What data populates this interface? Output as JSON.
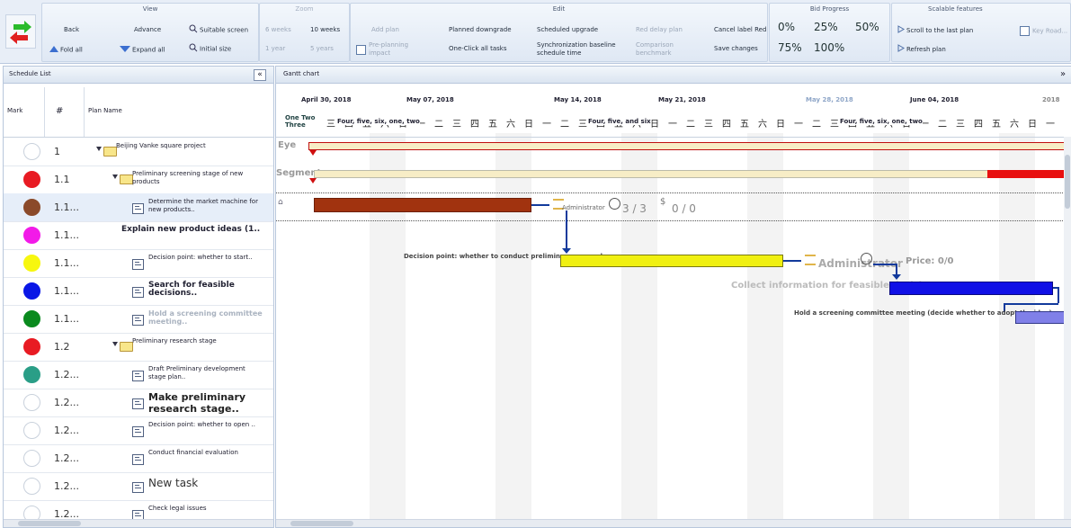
{
  "ribbon": {
    "view": {
      "title": "View",
      "back": "Back",
      "advance": "Advance",
      "suitable_screen": "Suitable screen",
      "fold_all": "Fold all",
      "expand_all": "Expand all",
      "initial_size": "Initial size"
    },
    "zoom": {
      "title": "Zoom",
      "six_weeks": "6 weeks",
      "ten_weeks": "10 weeks",
      "one_year": "1 year",
      "five_years": "5 years"
    },
    "edit": {
      "title": "Edit",
      "add_plan": "Add plan",
      "planned_downgrade": "Planned downgrade",
      "scheduled_upgrade": "Scheduled upgrade",
      "red_delay_plan": "Red delay plan",
      "cancel_label_red": "Cancel label Red",
      "preplanning_impact": "Pre-planning impact",
      "one_click_all_tasks": "One-Click all tasks",
      "sync_baseline": "Synchronization baseline schedule time",
      "comparison_benchmark": "Comparison benchmark",
      "save_changes": "Save changes"
    },
    "bid": {
      "title": "Bid Progress",
      "p0": "0%",
      "p25": "25%",
      "p50": "50%",
      "p75": "75%",
      "p100": "100%"
    },
    "scalable": {
      "title": "Scalable features",
      "scroll_last": "Scroll to the last plan",
      "refresh": "Refresh plan",
      "key_road": "Key Road..."
    }
  },
  "schedule": {
    "title": "Schedule List",
    "cols": {
      "mark": "Mark",
      "num": "#",
      "name": "Plan Name"
    },
    "rows": [
      {
        "num": "1",
        "name": "Beijing Vanke square project",
        "color": "#ffffff"
      },
      {
        "num": "1.1",
        "name": "Preliminary screening stage of new products",
        "color": "#e81b23"
      },
      {
        "num": "1.1...",
        "name": "Determine the market machine for new products..",
        "color": "#8b4a2a"
      },
      {
        "num": "1.1...",
        "name": "Explain new product ideas (1..",
        "color": "#f21ae8"
      },
      {
        "num": "1.1...",
        "name": "Decision point: whether to start..",
        "color": "#f7f70f"
      },
      {
        "num": "1.1...",
        "name": "Search for feasible decisions..",
        "color": "#0a17e6"
      },
      {
        "num": "1.1...",
        "name": "Hold a screening committee meeting..",
        "color": "#0a8a1e"
      },
      {
        "num": "1.2",
        "name": "Preliminary research stage",
        "color": "#e81b23"
      },
      {
        "num": "1.2...",
        "name": "Draft Preliminary development stage plan..",
        "color": "#2a9e87"
      },
      {
        "num": "1.2...",
        "name": "Make preliminary research stage..",
        "color": "#ffffff"
      },
      {
        "num": "1.2...",
        "name": "Decision point: whether to open ..",
        "color": "#ffffff"
      },
      {
        "num": "1.2...",
        "name": "Conduct financial evaluation",
        "color": "#ffffff"
      },
      {
        "num": "1.2...",
        "name": "New task",
        "color": "#ffffff"
      },
      {
        "num": "1.2...",
        "name": "Check legal issues",
        "color": "#ffffff"
      }
    ]
  },
  "gantt": {
    "title": "Gantt chart",
    "dates": [
      "April 30, 2018",
      "May 07, 2018",
      "May 14, 2018",
      "May 21, 2018",
      "May 28, 2018",
      "June 04, 2018",
      "2018"
    ],
    "week_label_1": "One Two Three",
    "week_label_2": "Four, five, six, one, two",
    "week_label_3": "Four, five, and six",
    "eye": "Eye",
    "segment": "Segment",
    "admin_small": "Administrator",
    "progress_a": "3 / 3",
    "progress_b": "0 / 0",
    "admin_big": "Administrator",
    "price": "Price: 0/0",
    "decision_label": "Decision point: whether to conduct preliminary research",
    "collect_label": "Collect information for feasible decisions",
    "meeting_label": "Hold a screening committee meeting (decide whether to adopt the idea)"
  }
}
